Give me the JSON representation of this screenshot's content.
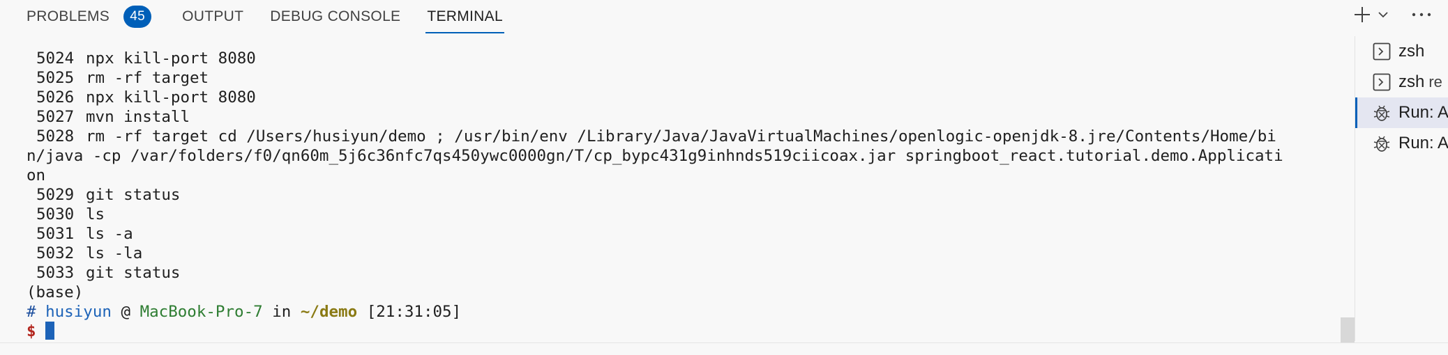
{
  "tabs": [
    {
      "label": "PROBLEMS",
      "badge": "45"
    },
    {
      "label": "OUTPUT"
    },
    {
      "label": "DEBUG CONSOLE"
    },
    {
      "label": "TERMINAL",
      "active": true
    }
  ],
  "actions": {
    "new_terminal_icon": "plus-icon",
    "dropdown_icon": "chevron-down-icon",
    "more_icon": "ellipsis-icon"
  },
  "terminal": {
    "history": [
      {
        "num": "5024",
        "cmd": "npx kill-port 8080"
      },
      {
        "num": "5025",
        "cmd": "rm -rf target"
      },
      {
        "num": "5026",
        "cmd": "npx kill-port 8080"
      },
      {
        "num": "5027",
        "cmd": "mvn install"
      },
      {
        "num": "5028",
        "cmd": "rm -rf target cd /Users/husiyun/demo ; /usr/bin/env /Library/Java/JavaVirtualMachines/openlogic-openjdk-8.jre/Contents/Home/bi"
      }
    ],
    "wrap_lines": [
      "n/java -cp /var/folders/f0/qn60m_5j6c36nfc7qs450ywc0000gn/T/cp_bypc431g9inhnds519ciicoax.jar springboot_react.tutorial.demo.Applicati",
      "on"
    ],
    "history2": [
      {
        "num": "5029",
        "cmd": "git status"
      },
      {
        "num": "5030",
        "cmd": "ls"
      },
      {
        "num": "5031",
        "cmd": "ls -a"
      },
      {
        "num": "5032",
        "cmd": "ls -la"
      },
      {
        "num": "5033",
        "cmd": "git status"
      }
    ],
    "env": "(base)",
    "prompt": {
      "hash": "#",
      "user": "husiyun",
      "at": "@",
      "host": "MacBook-Pro-7",
      "in": "in",
      "dir": "~/demo",
      "time": "[21:31:05]",
      "dollar": "$"
    }
  },
  "side_terminals": [
    {
      "label": "zsh",
      "icon": "terminal-icon"
    },
    {
      "label": "zsh",
      "sub": "re",
      "icon": "terminal-icon"
    },
    {
      "label": "Run: A",
      "icon": "debug-icon",
      "selected": true
    },
    {
      "label": "Run: A",
      "icon": "debug-icon"
    }
  ],
  "colors": {
    "accent": "#005fb8",
    "prompt_user": "#1d63b8",
    "prompt_host": "#2e7d32",
    "prompt_dir": "#8a7a14",
    "prompt_dollar": "#b3261e"
  }
}
